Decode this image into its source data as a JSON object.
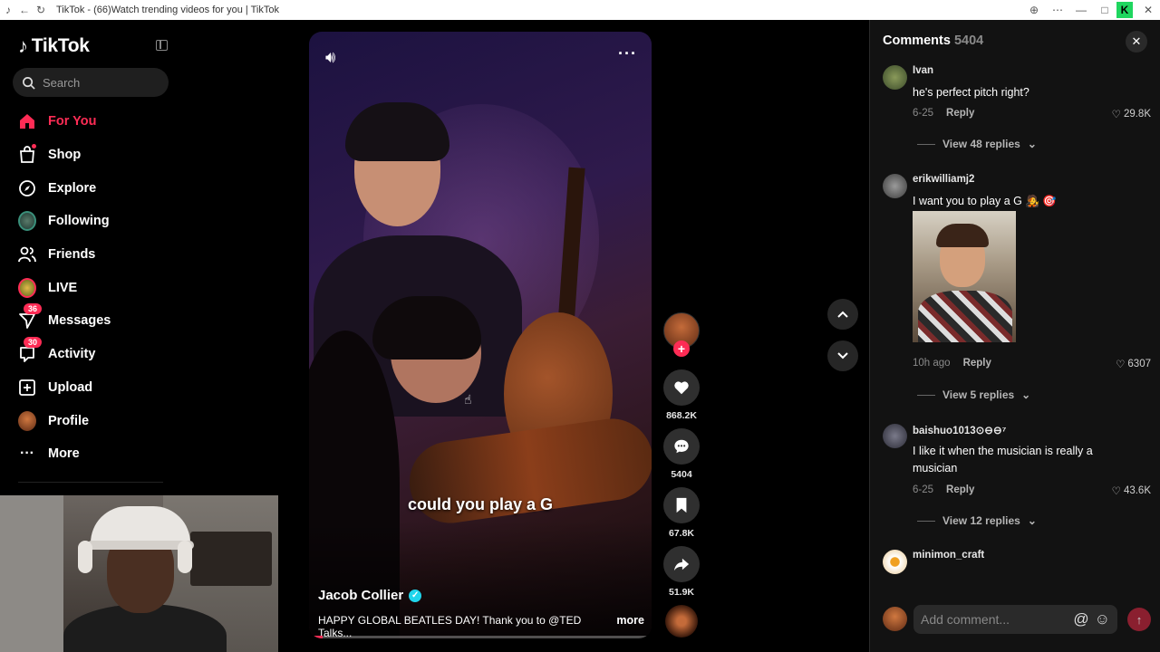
{
  "browser": {
    "tab_title": "TikTok - (66)Watch trending videos for you | TikTok"
  },
  "sidebar": {
    "logo": "TikTok",
    "search_placeholder": "Search",
    "items": [
      {
        "label": "For You",
        "icon": "home-icon",
        "active": true
      },
      {
        "label": "Shop",
        "icon": "shop-icon"
      },
      {
        "label": "Explore",
        "icon": "compass-icon"
      },
      {
        "label": "Following",
        "icon": "following-avatar-icon"
      },
      {
        "label": "Friends",
        "icon": "friends-icon"
      },
      {
        "label": "LIVE",
        "icon": "live-icon"
      },
      {
        "label": "Messages",
        "icon": "messages-icon",
        "badge": "36"
      },
      {
        "label": "Activity",
        "icon": "activity-icon",
        "badge": "30"
      },
      {
        "label": "Upload",
        "icon": "upload-icon"
      },
      {
        "label": "Profile",
        "icon": "profile-avatar-icon"
      },
      {
        "label": "More",
        "icon": "more-dots-icon"
      }
    ]
  },
  "video": {
    "caption_overlay": "could you play a G",
    "author": "Jacob Collier",
    "description": "HAPPY GLOBAL BEATLES DAY! Thank you to @TED Talks...",
    "more_label": "more",
    "progress": 0.04
  },
  "actions": {
    "likes": "868.2K",
    "comments": "5404",
    "saves": "67.8K",
    "shares": "51.9K"
  },
  "comments_panel": {
    "title": "Comments",
    "count": "5404",
    "input_placeholder": "Add comment...",
    "reply_label": "Reply",
    "items": [
      {
        "user": "Ivan",
        "text": "he's perfect pitch right?",
        "date": "6-25",
        "likes": "29.8K",
        "replies": "View 48 replies"
      },
      {
        "user": "erikwilliamj2",
        "text": "I want you to play a G 🧑‍🎤 🎯",
        "date": "10h ago",
        "likes": "6307",
        "replies": "View 5 replies"
      },
      {
        "user": "baishuo1013⊙⊖⊖⁷",
        "text": "I like it when the musician is really a musician",
        "date": "6-25",
        "likes": "43.6K",
        "replies": "View 12 replies"
      },
      {
        "user": "minimon_craft"
      }
    ]
  },
  "colors": {
    "accent": "#fe2c55",
    "verified": "#20d5ec",
    "panel_bg": "#121212"
  }
}
